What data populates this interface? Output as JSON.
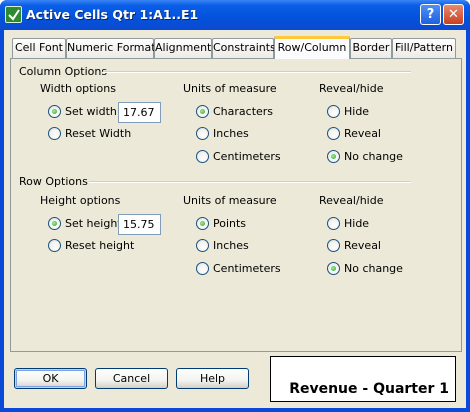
{
  "window": {
    "title": "Active Cells  Qtr 1:A1..E1",
    "help_glyph": "?",
    "close_glyph": "✕"
  },
  "tabs": [
    {
      "label": "Cell Font",
      "active": false
    },
    {
      "label": "Numeric Format",
      "active": false
    },
    {
      "label": "Alignment",
      "active": false
    },
    {
      "label": "Constraints",
      "active": false
    },
    {
      "label": "Row/Column",
      "active": true
    },
    {
      "label": "Border",
      "active": false
    },
    {
      "label": "Fill/Pattern",
      "active": false
    }
  ],
  "column_options": {
    "title": "Column Options",
    "width": {
      "heading": "Width options",
      "set_label": "Set width",
      "set_selected": true,
      "value": "17.67",
      "reset_label": "Reset Width",
      "reset_selected": false
    },
    "units": {
      "heading": "Units of measure",
      "options": [
        {
          "label": "Characters",
          "selected": true
        },
        {
          "label": "Inches",
          "selected": false
        },
        {
          "label": "Centimeters",
          "selected": false
        }
      ]
    },
    "reveal": {
      "heading": "Reveal/hide",
      "options": [
        {
          "label": "Hide",
          "selected": false
        },
        {
          "label": "Reveal",
          "selected": false
        },
        {
          "label": "No change",
          "selected": true
        }
      ]
    }
  },
  "row_options": {
    "title": "Row Options",
    "height": {
      "heading": "Height options",
      "set_label": "Set height",
      "set_selected": true,
      "value": "15.75",
      "reset_label": "Reset height",
      "reset_selected": false
    },
    "units": {
      "heading": "Units of measure",
      "options": [
        {
          "label": "Points",
          "selected": true
        },
        {
          "label": "Inches",
          "selected": false
        },
        {
          "label": "Centimeters",
          "selected": false
        }
      ]
    },
    "reveal": {
      "heading": "Reveal/hide",
      "options": [
        {
          "label": "Hide",
          "selected": false
        },
        {
          "label": "Reveal",
          "selected": false
        },
        {
          "label": "No change",
          "selected": true
        }
      ]
    }
  },
  "buttons": {
    "ok": "OK",
    "cancel": "Cancel",
    "help": "Help"
  },
  "preview": {
    "text": "Revenue - Quarter 1"
  },
  "colors": {
    "titlebar": "#0a5ee8",
    "dialog_face": "#ece9d8",
    "active_tab_accent": "#ffc73c",
    "radio_selected": "#21a121"
  }
}
